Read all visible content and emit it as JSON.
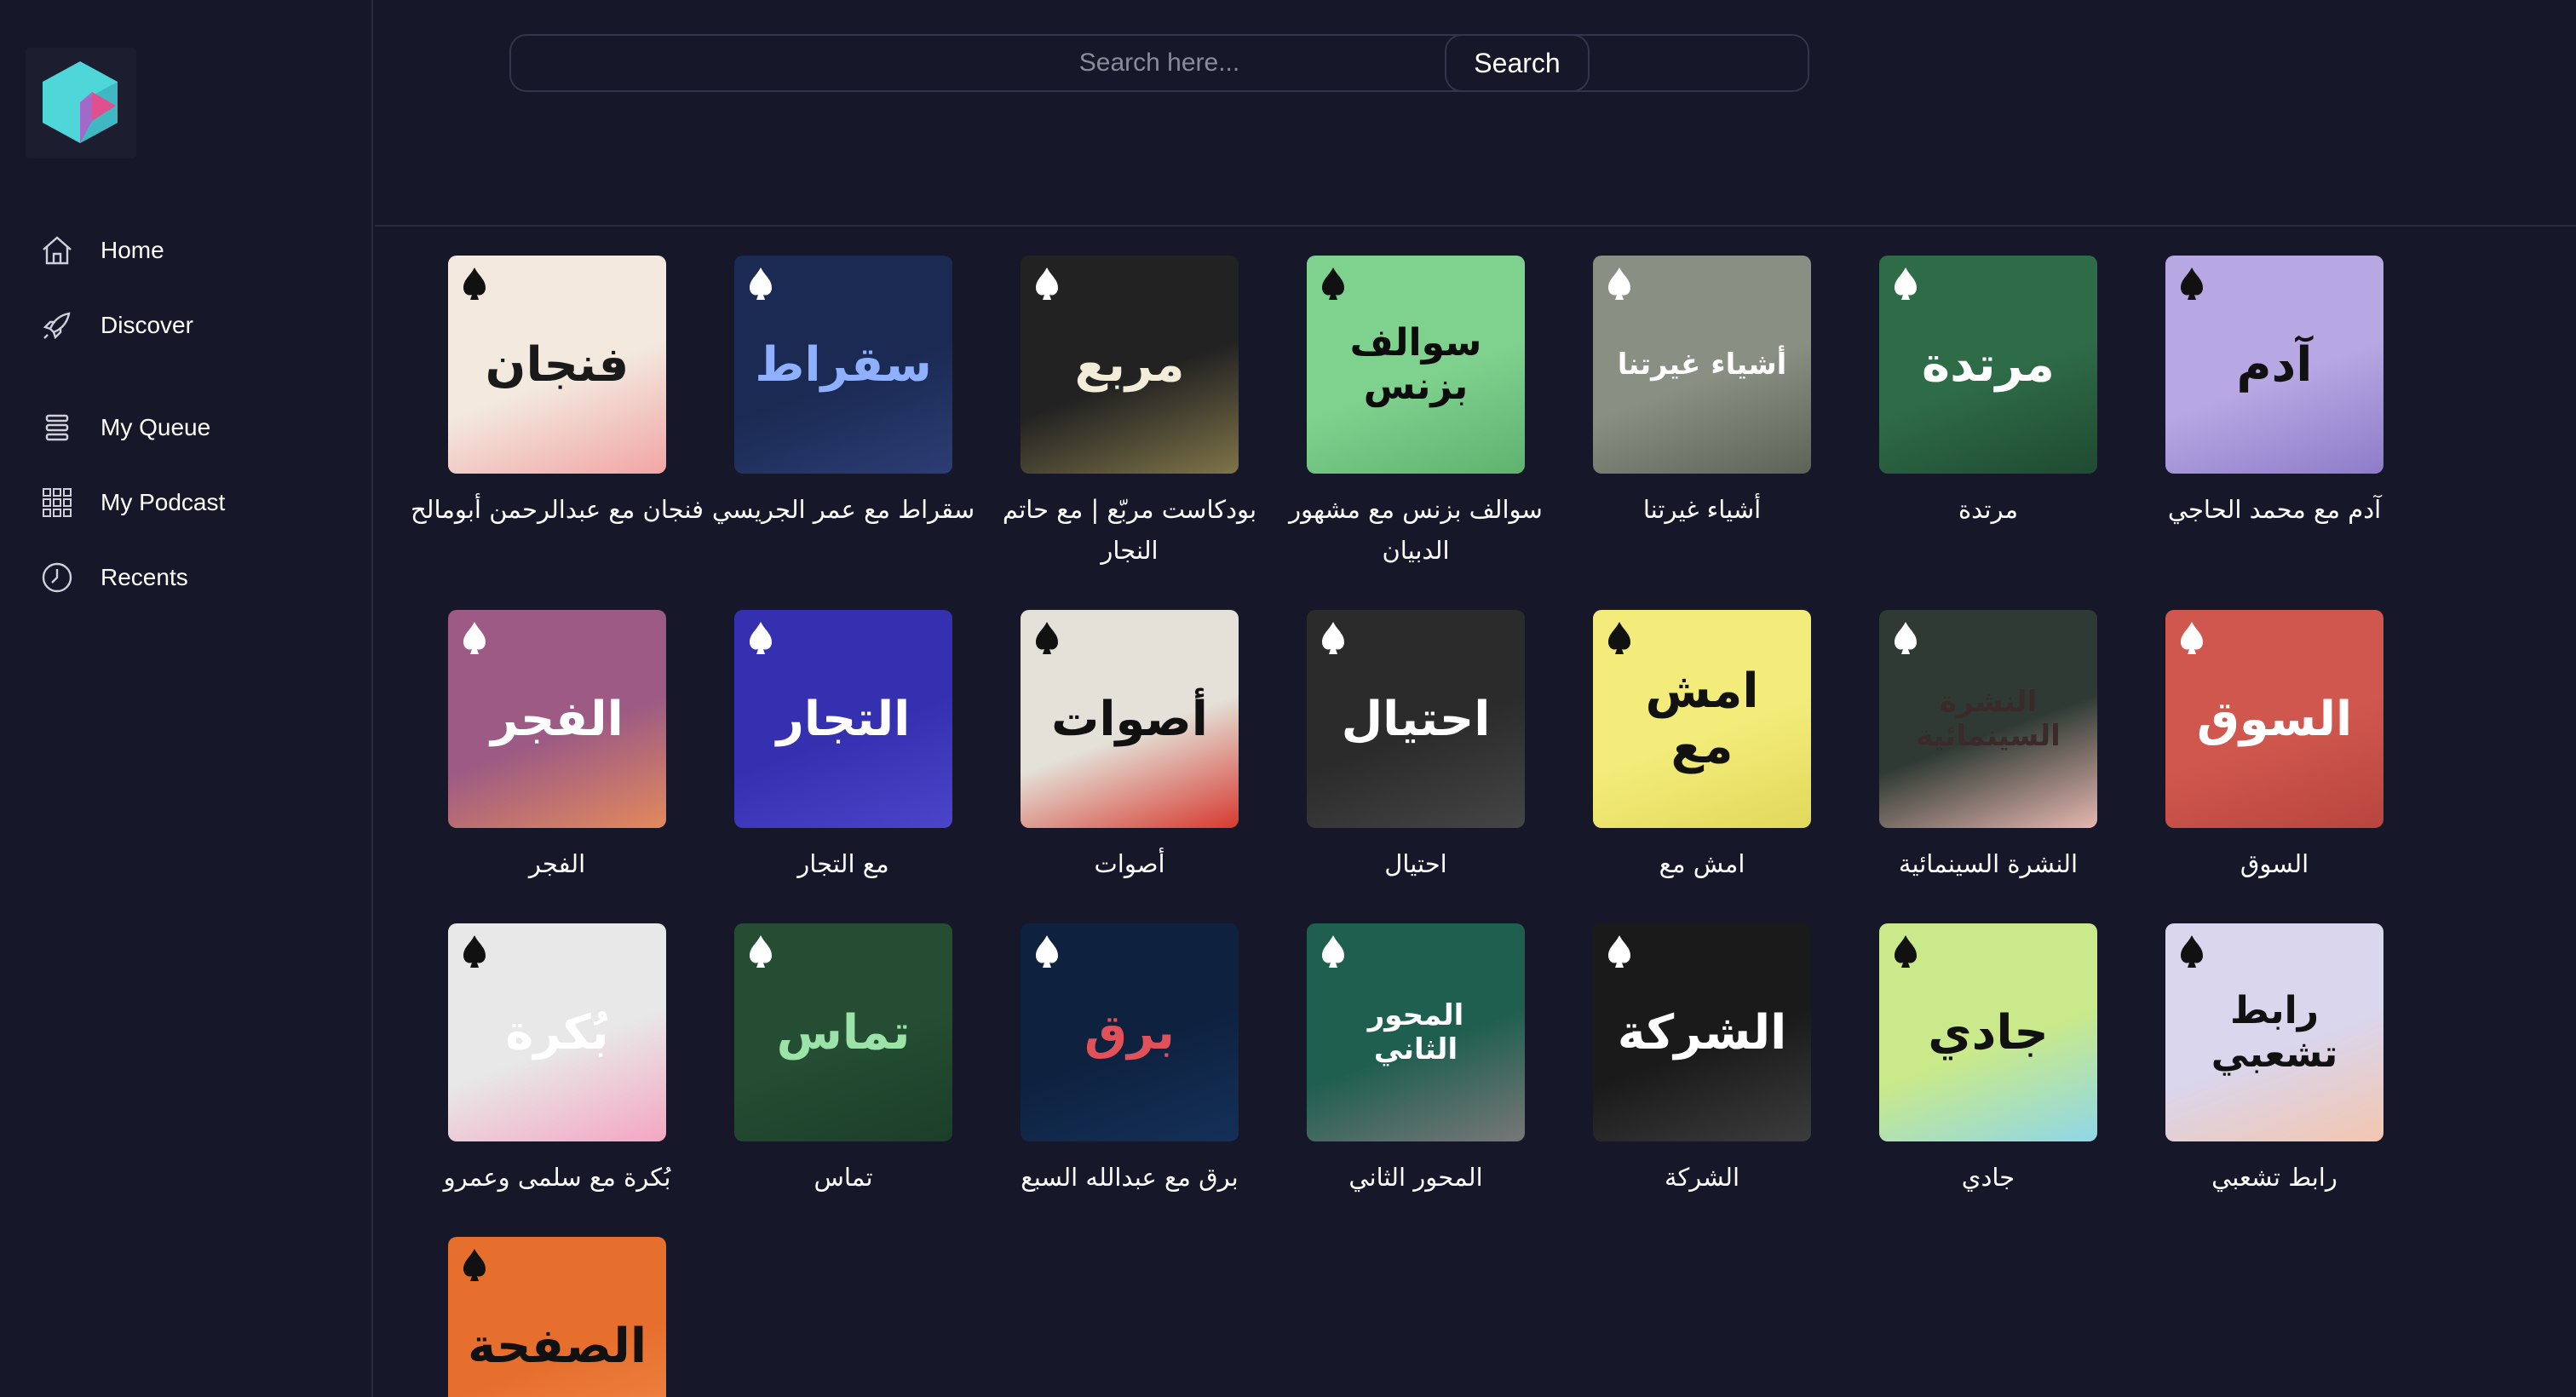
{
  "sidebar": {
    "logo_icon": "hexagon-logo-icon",
    "items": [
      {
        "label": "Home",
        "icon": "home-icon"
      },
      {
        "label": "Discover",
        "icon": "rocket-icon"
      },
      {
        "label": "My Queue",
        "icon": "queue-icon"
      },
      {
        "label": "My Podcast",
        "icon": "grid-icon"
      },
      {
        "label": "Recents",
        "icon": "clock-icon"
      }
    ]
  },
  "search": {
    "placeholder": "Search here...",
    "value": "",
    "button_label": "Search"
  },
  "podcasts": [
    {
      "title": "فنجان مع عبدالرحمن أبومالح",
      "cover_text": "فنجان",
      "bg": "#f3e9de",
      "fg": "#1a1a1a",
      "accent": "#f2a5a5"
    },
    {
      "title": "سقراط مع عمر الجريسي",
      "cover_text": "سقراط",
      "bg": "#1a2a52",
      "fg": "#8fb0ff",
      "accent": "#2c3d75"
    },
    {
      "title": "بودكاست مربّع | مع حاتم النجار",
      "cover_text": "مربع",
      "bg": "#222222",
      "fg": "#f2ecd8",
      "accent": "#7f7448"
    },
    {
      "title": "سوالف بزنس مع مشهور الدبيان",
      "cover_text": "سوالف بزنس",
      "bg": "#7fd18e",
      "fg": "#0c0c0c",
      "accent": "#5fb36f"
    },
    {
      "title": "أشياء غيرتنا",
      "cover_text": "أشياء غيرتنا",
      "bg": "#8a8f84",
      "fg": "#ffffff",
      "accent": "#5e6357"
    },
    {
      "title": "مرتدة",
      "cover_text": "مرتدة",
      "bg": "#2e6b47",
      "fg": "#ffffff",
      "accent": "#1f4a31"
    },
    {
      "title": "آدم مع محمد الحاجي",
      "cover_text": "آدم",
      "bg": "#b7a7e3",
      "fg": "#111111",
      "accent": "#8e7cc9"
    },
    {
      "title": "الفجر",
      "cover_text": "الفجر",
      "bg": "#9c5a84",
      "fg": "#ffffff",
      "accent": "#e2895d"
    },
    {
      "title": "مع التجار",
      "cover_text": "التجار",
      "bg": "#3530b0",
      "fg": "#ffffff",
      "accent": "#4a45c9"
    },
    {
      "title": "أصوات",
      "cover_text": "أصوات",
      "bg": "#e4e1d8",
      "fg": "#111111",
      "accent": "#d63a2f"
    },
    {
      "title": "احتيال",
      "cover_text": "احتيال",
      "bg": "#2b2b2b",
      "fg": "#ffffff",
      "accent": "#454545"
    },
    {
      "title": "امش مع",
      "cover_text": "امش مع",
      "bg": "#f3ec7a",
      "fg": "#111111",
      "accent": "#e1d95a"
    },
    {
      "title": "النشرة السينمائية",
      "cover_text": "النشرة السينمائية",
      "bg": "#2f3a34",
      "fg": "#3b2a2a",
      "accent": "#e6b7b0"
    },
    {
      "title": "السوق",
      "cover_text": "السوق",
      "bg": "#d0574e",
      "fg": "#ffffff",
      "accent": "#b8463e"
    },
    {
      "title": "بُكرة مع سلمى وعمرو",
      "cover_text": "بُكرة",
      "bg": "#e8e8e8",
      "fg": "#ffffff",
      "accent": "#f4a6c2"
    },
    {
      "title": "تماس",
      "cover_text": "تماس",
      "bg": "#244d33",
      "fg": "#9be3a8",
      "accent": "#1c3e29"
    },
    {
      "title": "برق مع عبدالله السبع",
      "cover_text": "برق",
      "bg": "#0e2240",
      "fg": "#e0515a",
      "accent": "#143058"
    },
    {
      "title": "المحور الثاني",
      "cover_text": "المحور الثاني",
      "bg": "#1f5f50",
      "fg": "#ffffff",
      "accent": "#777777"
    },
    {
      "title": "الشركة",
      "cover_text": "الشركة",
      "bg": "#1a1a1a",
      "fg": "#ffffff",
      "accent": "#3c3c3c"
    },
    {
      "title": "جادي",
      "cover_text": "جادي",
      "bg": "#c9e98a",
      "fg": "#111111",
      "accent": "#8fd7e8"
    },
    {
      "title": "رابط تشعبي",
      "cover_text": "رابط تشعبي",
      "bg": "#d9d6ee",
      "fg": "#111111",
      "accent": "#f3c6b0"
    },
    {
      "title": "",
      "cover_text": "الصفحة",
      "bg": "#e76f2e",
      "fg": "#111111",
      "accent": "#f08a48"
    }
  ]
}
